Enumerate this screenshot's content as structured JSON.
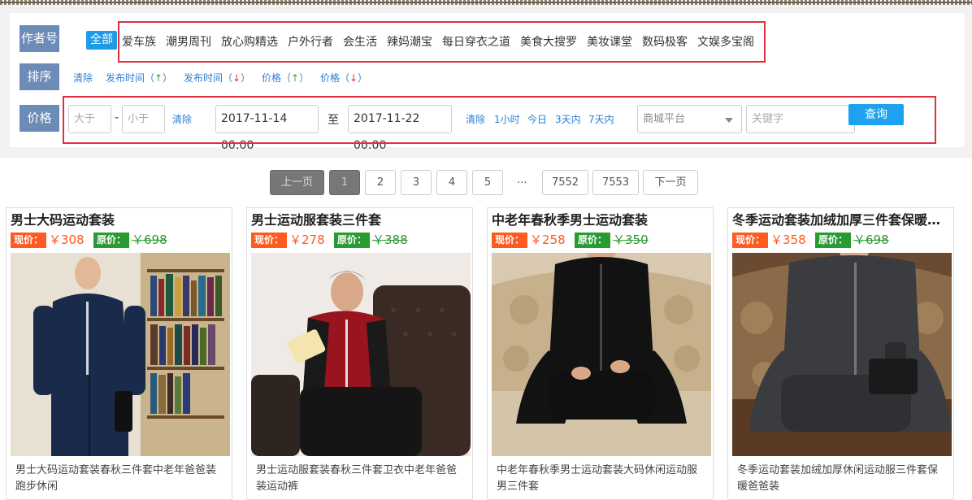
{
  "filters": {
    "author": {
      "label": "作者号",
      "all": "全部",
      "items": [
        "爱车族",
        "潮男周刊",
        "放心购精选",
        "户外行者",
        "会生活",
        "辣妈潮宝",
        "每日穿衣之道",
        "美食大搜罗",
        "美妆课堂",
        "数码极客",
        "文娱多宝阁"
      ]
    },
    "sort": {
      "label": "排序",
      "clear": "清除",
      "pub_time_asc": "发布时间（",
      "pub_time_desc": "发布时间（",
      "price_asc": "价格（",
      "price_desc": "价格（",
      "close": "）",
      "up": "↑",
      "down": "↓"
    },
    "price": {
      "label": "价格",
      "min_placeholder": "大于",
      "dash": "-",
      "max_placeholder": "小于",
      "clear": "清除",
      "start_time": "2017-11-14 00:00",
      "to": "至",
      "end_time": "2017-11-22 00:00",
      "time_clear": "清除",
      "quick": [
        "1小时",
        "今日",
        "3天内",
        "7天内"
      ],
      "platform_placeholder": "商城平台",
      "keyword_placeholder": "关键字",
      "query_button": "查询"
    }
  },
  "pagination": {
    "prev": "上一页",
    "pages": [
      "1",
      "2",
      "3",
      "4",
      "5"
    ],
    "ellipsis": "...",
    "last_pages": [
      "7552",
      "7553"
    ],
    "next": "下一页",
    "current": "1"
  },
  "products": [
    {
      "title": "男士大码运动套装",
      "now_label": "现价：",
      "now_price": "￥308",
      "orig_label": "原价：",
      "orig_price": "￥698",
      "desc": "男士大码运动套装春秋三件套中老年爸爸装跑步休闲"
    },
    {
      "title": "男士运动服套装三件套",
      "now_label": "现价：",
      "now_price": "￥278",
      "orig_label": "原价：",
      "orig_price": "￥388",
      "desc": "男士运动服套装春秋三件套卫衣中老年爸爸装运动裤"
    },
    {
      "title": "中老年春秋季男士运动套装",
      "now_label": "现价：",
      "now_price": "￥258",
      "orig_label": "原价：",
      "orig_price": "￥350",
      "desc": "中老年春秋季男士运动套装大码休闲运动服男三件套"
    },
    {
      "title": "冬季运动套装加绒加厚三件套保暖爸爸装",
      "now_label": "现价：",
      "now_price": "￥358",
      "orig_label": "原价：",
      "orig_price": "￥698",
      "desc": "冬季运动套装加绒加厚休闲运动服三件套保暖爸爸装"
    }
  ],
  "colors": {
    "label_bg": "#6d8bb7",
    "accent_blue": "#1e9be6",
    "highlight_red": "#e03040",
    "now_price": "#ff5a1f",
    "orig_price": "#2a9a32"
  }
}
